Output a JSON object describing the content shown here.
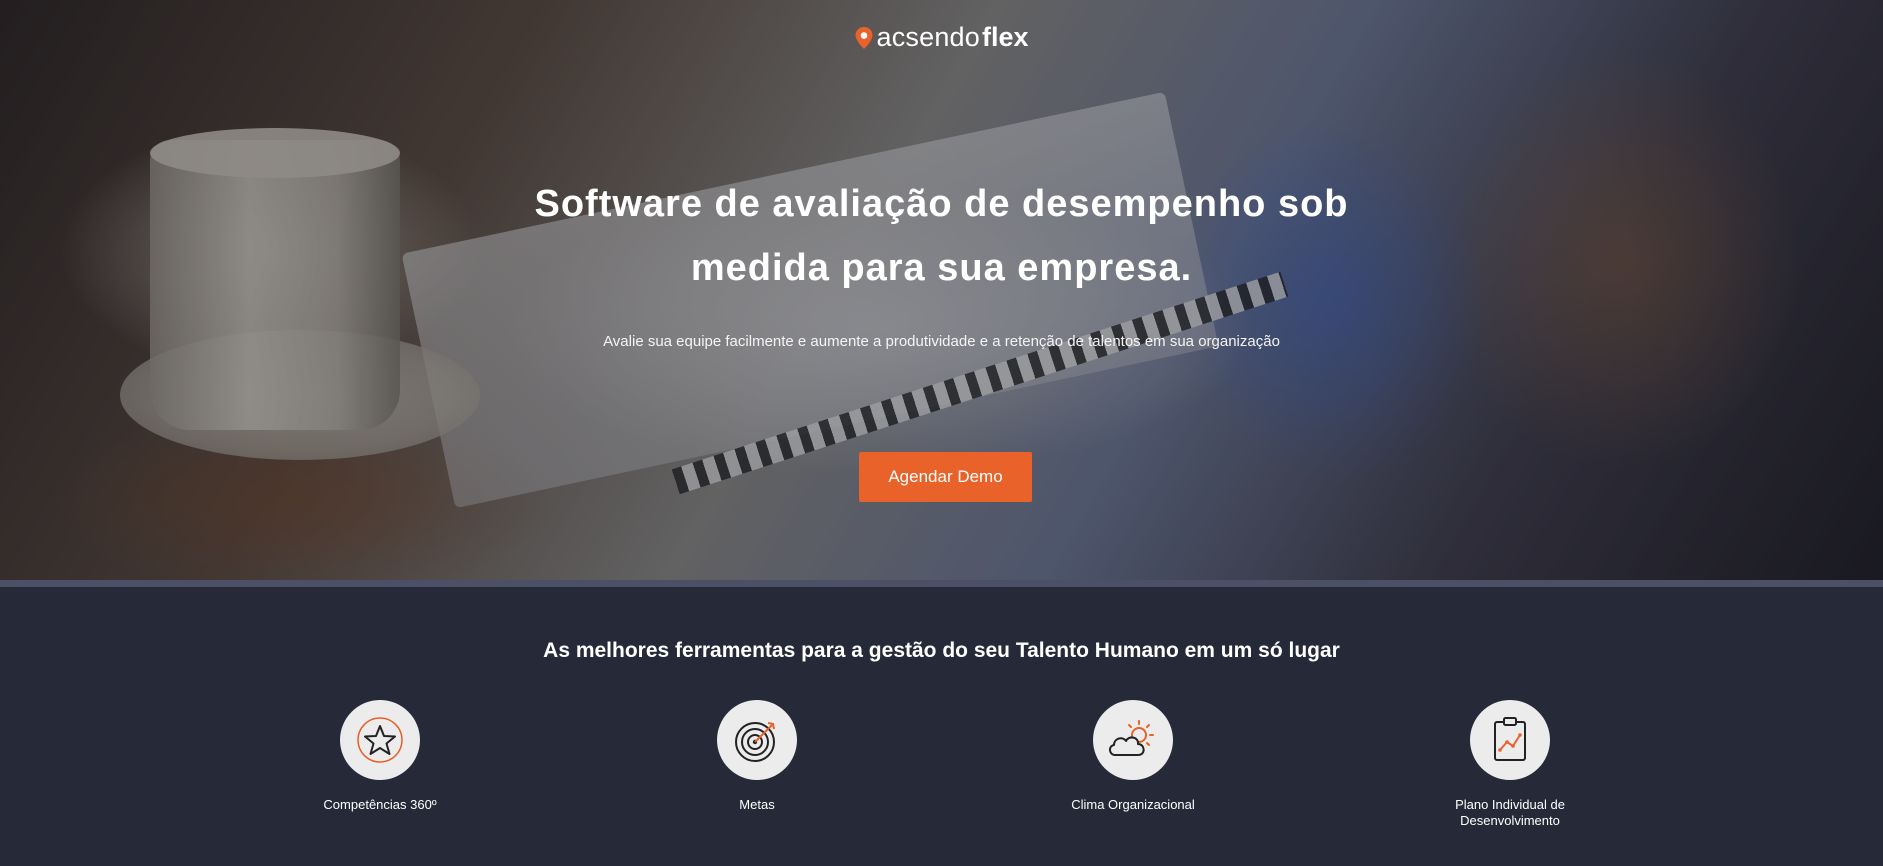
{
  "brand": {
    "name_light": "acsendo",
    "name_bold": "flex",
    "accent_color": "#e8622a"
  },
  "hero": {
    "title_line1": "Software de avaliação de desempenho sob",
    "title_line2": "medida para sua empresa.",
    "subtitle": "Avalie sua equipe facilmente e aumente a produtividade e a retenção de talentos em sua organização",
    "cta_label": "Agendar Demo"
  },
  "features": {
    "title": "As melhores ferramentas para a gestão do seu Talento Humano em um só lugar",
    "items": [
      {
        "label": "Competências 360º",
        "icon": "star-icon"
      },
      {
        "label": "Metas",
        "icon": "target-icon"
      },
      {
        "label": "Clima Organizacional",
        "icon": "cloud-sun-icon"
      },
      {
        "label_line1": "Plano Individual de",
        "label_line2": "Desenvolvimento",
        "icon": "clipboard-chart-icon"
      }
    ]
  }
}
